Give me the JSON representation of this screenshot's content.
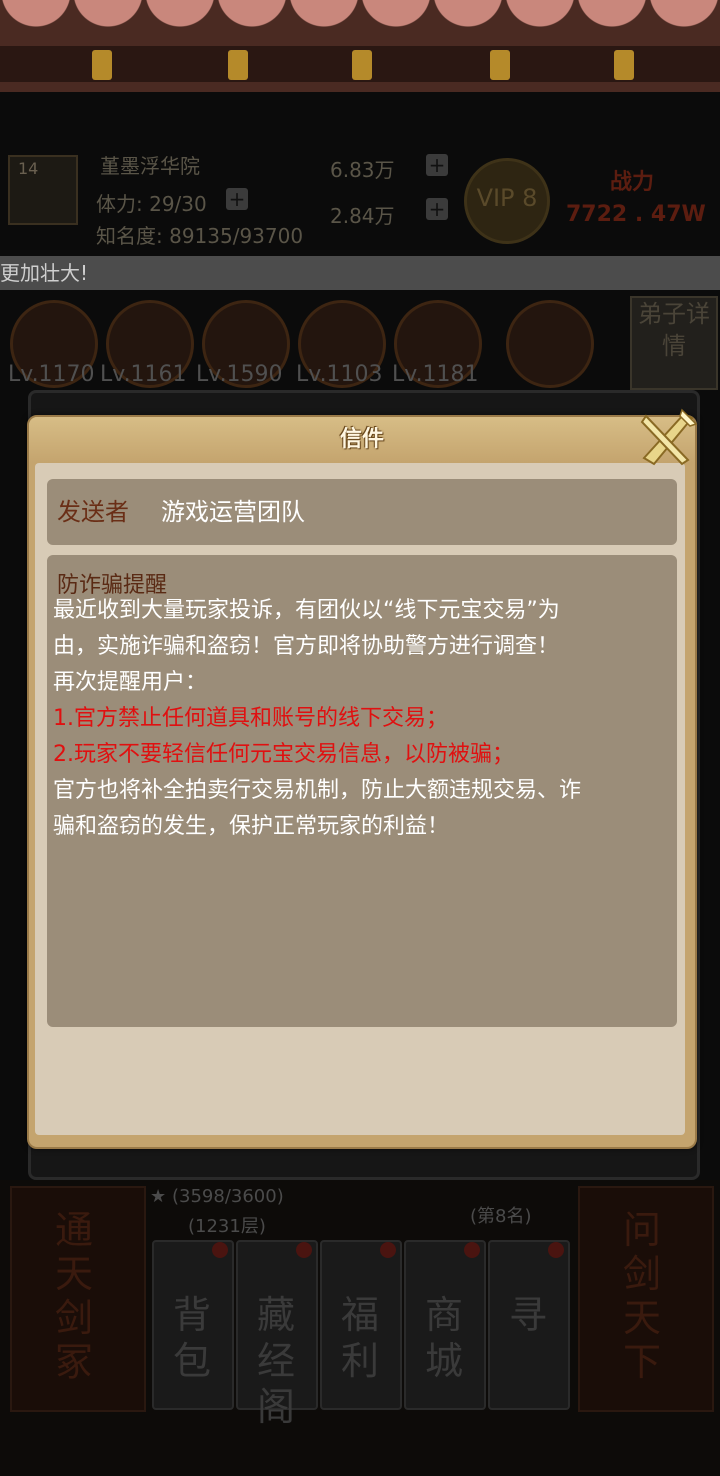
{
  "background": {
    "player": {
      "level": "14",
      "name": "堇墨浮华院",
      "stamina": "体力: 29/30",
      "fame": "知名度: 89135/93700",
      "silver": "6.83万",
      "gold": "2.84万",
      "vip": "VIP 8",
      "power_label": "战力",
      "power_value": "7722 . 47W"
    },
    "notice": "更加壮大!",
    "disciple_levels": [
      "Lv.1170",
      "Lv.1161",
      "Lv.1590",
      "Lv.1103",
      "Lv.1181"
    ],
    "disciple_detail": "弟子详情",
    "tower_stars": "(3598/3600)",
    "tower_floor": "(1231层)",
    "rank": "(第8名)",
    "left_banner": "通天剑冢",
    "right_banner": "问剑天下",
    "menu": [
      {
        "label": "背包"
      },
      {
        "label": "藏经阁"
      },
      {
        "label": "福利"
      },
      {
        "label": "商城"
      },
      {
        "label": "寻"
      }
    ]
  },
  "mail": {
    "title": "信件",
    "sender_label": "发送者",
    "sender_name": "游戏运营团队",
    "subject": "防诈骗提醒",
    "lines": [
      {
        "text": "最近收到大量玩家投诉，有团伙以“线下元宝交易”为",
        "color": "#ffffff"
      },
      {
        "text": "由，实施诈骗和盗窃！官方即将协助警方进行调查！",
        "color": "#ffffff"
      },
      {
        "text": "再次提醒用户：",
        "color": "#ffffff"
      },
      {
        "text": "1.官方禁止任何道具和账号的线下交易；",
        "color": "#e01010"
      },
      {
        "text": "2.玩家不要轻信任何元宝交易信息，以防被骗；",
        "color": "#e01010"
      },
      {
        "text": "官方也将补全拍卖行交易机制，防止大额违规交易、诈",
        "color": "#ffffff"
      },
      {
        "text": "骗和盗窃的发生，保护正常玩家的利益！",
        "color": "#ffffff"
      }
    ],
    "close_icon": "close-x-icon"
  }
}
